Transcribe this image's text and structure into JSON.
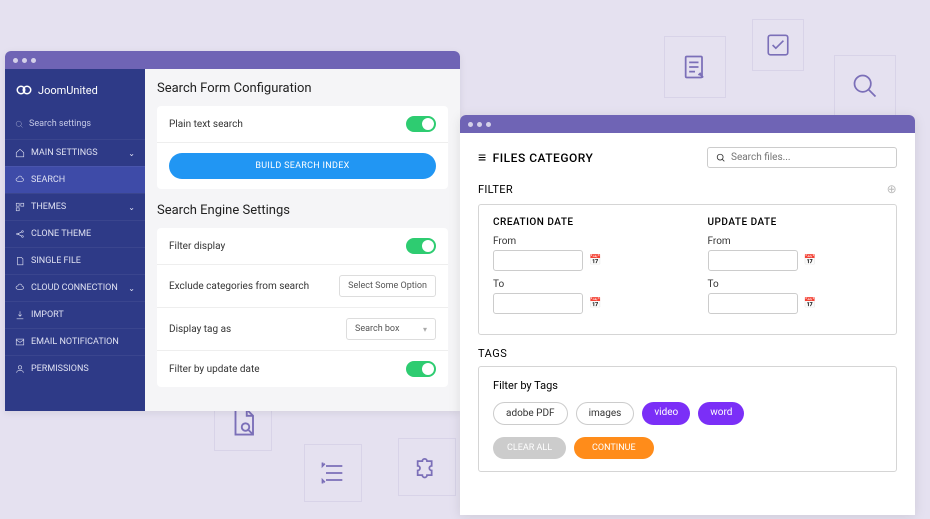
{
  "brand": "JoomUnited",
  "sidebar": {
    "search_label": "Search settings",
    "items": [
      {
        "label": "MAIN SETTINGS",
        "expandable": true
      },
      {
        "label": "SEARCH",
        "expandable": false
      },
      {
        "label": "THEMES",
        "expandable": true
      },
      {
        "label": "CLONE THEME",
        "expandable": false
      },
      {
        "label": "SINGLE FILE",
        "expandable": false
      },
      {
        "label": "CLOUD CONNECTION",
        "expandable": true
      },
      {
        "label": "IMPORT",
        "expandable": false
      },
      {
        "label": "EMAIL NOTIFICATION",
        "expandable": false
      },
      {
        "label": "PERMISSIONS",
        "expandable": false
      }
    ]
  },
  "form": {
    "title": "Search Form Configuration",
    "plain_text": "Plain text search",
    "build_btn": "BUILD SEARCH INDEX"
  },
  "engine": {
    "title": "Search Engine Settings",
    "filter_display": "Filter display",
    "exclude": "Exclude categories from search",
    "exclude_value": "Select Some Option",
    "display_tag": "Display tag as",
    "display_tag_value": "Search box",
    "filter_update": "Filter by update date"
  },
  "files": {
    "title": "FILES CATEGORY",
    "search_placeholder": "Search files...",
    "filter_label": "FILTER",
    "creation": "CREATION DATE",
    "update": "UPDATE DATE",
    "from": "From",
    "to": "To",
    "tags_label": "TAGS",
    "filter_by_tags": "Filter by Tags",
    "tags": [
      "adobe PDF",
      "images",
      "video",
      "word"
    ],
    "clear": "CLEAR ALL",
    "continue": "CONTINUE"
  }
}
